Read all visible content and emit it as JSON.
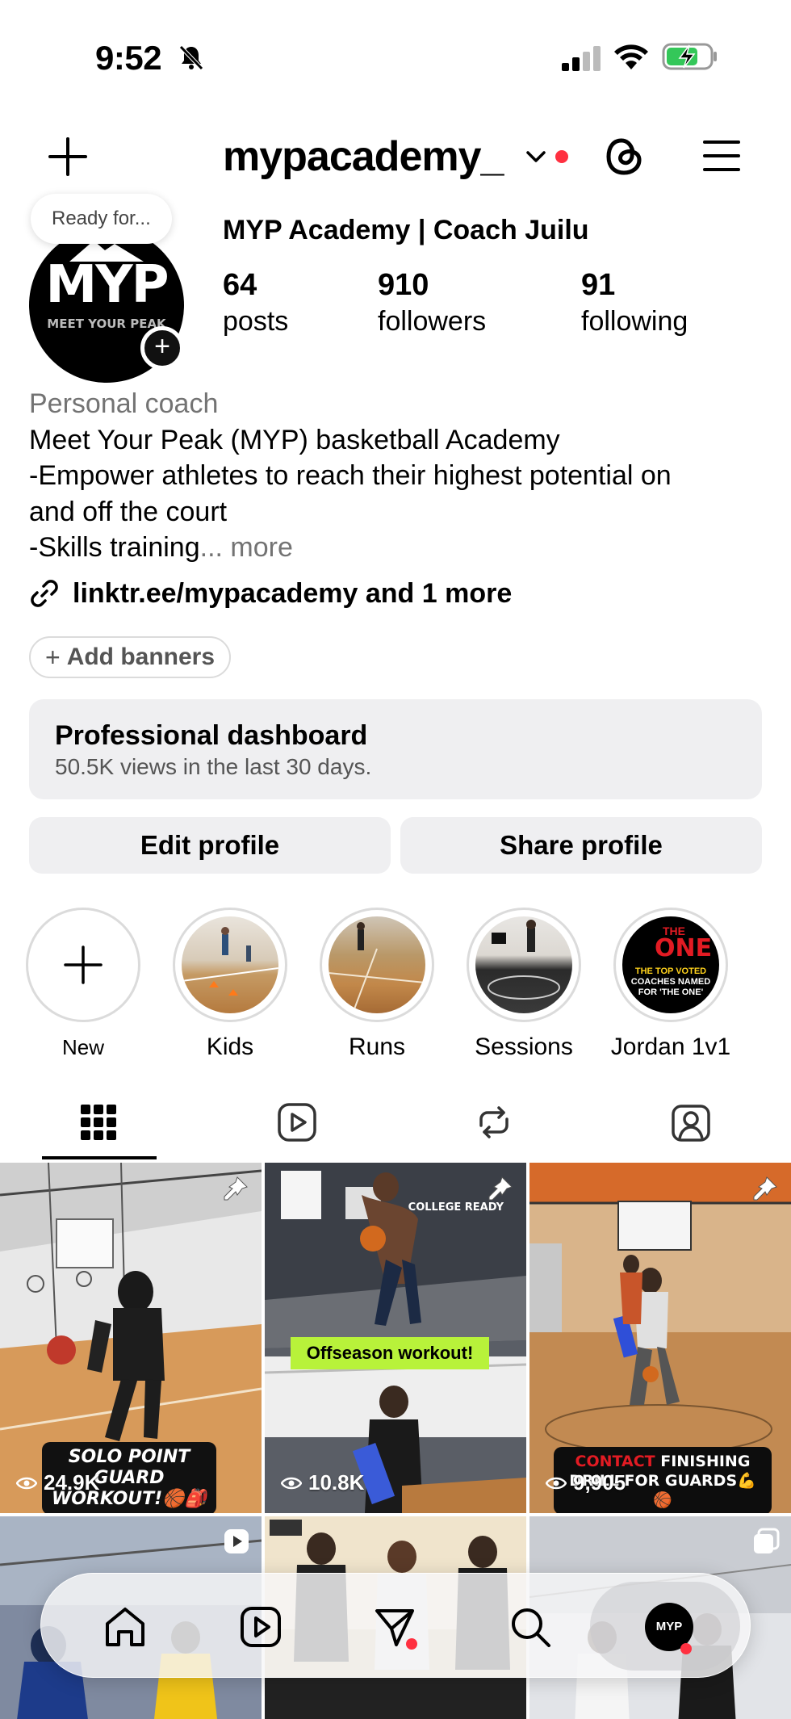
{
  "status_bar": {
    "time": "9:52"
  },
  "header": {
    "username": "mypacademy_"
  },
  "profile": {
    "note": "Ready for...",
    "avatar_logo": "MYP",
    "avatar_sub": "MEET YOUR PEAK",
    "display_name": "MYP Academy | Coach Juilu",
    "stats": [
      {
        "value": "64",
        "label": "posts"
      },
      {
        "value": "910",
        "label": "followers"
      },
      {
        "value": "91",
        "label": "following"
      }
    ],
    "category": "Personal coach",
    "bio_lines": [
      "Meet Your Peak (MYP) basketball Academy",
      "-Empower athletes to reach their highest potential on",
      "and off the court",
      "-Skills training"
    ],
    "bio_ellipsis": "...",
    "bio_more": " more",
    "link": "linktr.ee/mypacademy and 1 more"
  },
  "add_banners": {
    "label": "Add banners"
  },
  "dashboard": {
    "title": "Professional dashboard",
    "subtitle": "50.5K views in the last 30 days."
  },
  "buttons": {
    "edit": "Edit profile",
    "share": "Share profile"
  },
  "highlights": [
    {
      "label": "New"
    },
    {
      "label": "Kids"
    },
    {
      "label": "Runs"
    },
    {
      "label": "Sessions"
    },
    {
      "label": "Jordan 1v1",
      "cover_text": [
        "THE",
        "ONE",
        "THE TOP VOTED",
        "COACHES NAMED",
        "FOR 'THE ONE'"
      ]
    }
  ],
  "tabs": [
    "grid-tab",
    "reels-tab",
    "reposts-tab",
    "tagged-tab"
  ],
  "posts": [
    {
      "views": "24.9K",
      "caption": "SOLO POINT GUARD WORKOUT!🏀🎒",
      "pinned": true
    },
    {
      "views": "10.8K",
      "caption": "Offseason workout!",
      "overlay": "COLLEGE READY",
      "pinned": true
    },
    {
      "views": "9,905",
      "caption_red": "CONTACT",
      "caption": " FINISHING DRILL FOR GUARDS💪🏀",
      "pinned": true
    }
  ],
  "bottom_nav": [
    "home",
    "reels",
    "messages",
    "search",
    "profile"
  ],
  "colors": {
    "notification_red": "#ff3040",
    "muted_text": "#737373",
    "secondary_bg": "#efeff1"
  }
}
